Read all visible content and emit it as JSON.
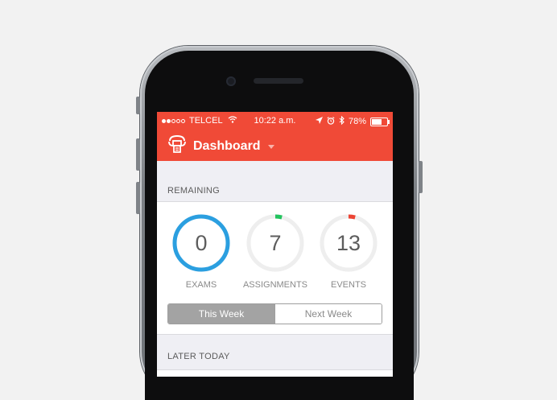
{
  "status_bar": {
    "carrier": "TELCEL",
    "time": "10:22 a.m.",
    "battery": "78%",
    "battery_level": 0.78,
    "signal_bars_filled": 2,
    "signal_bars_total": 5
  },
  "nav": {
    "title": "Dashboard",
    "logo_icon": "mortarboard-books-icon",
    "dropdown_icon": "caret-down-icon"
  },
  "remaining": {
    "header": "REMAINING",
    "stats": [
      {
        "label": "EXAMS",
        "value": "0",
        "ring_color": "#2b9fe0",
        "progress": 1.0
      },
      {
        "label": "ASSIGNMENTS",
        "value": "7",
        "ring_color": "#22c35e",
        "progress": 0.04
      },
      {
        "label": "EVENTS",
        "value": "13",
        "ring_color": "#ec4434",
        "progress": 0.04
      }
    ],
    "segmented": {
      "options": [
        "This Week",
        "Next Week"
      ],
      "selected": "This Week"
    }
  },
  "later_today": {
    "header": "LATER TODAY"
  },
  "colors": {
    "accent": "#f04a37",
    "background": "#efeff4",
    "ring_track": "#eeeeee"
  }
}
